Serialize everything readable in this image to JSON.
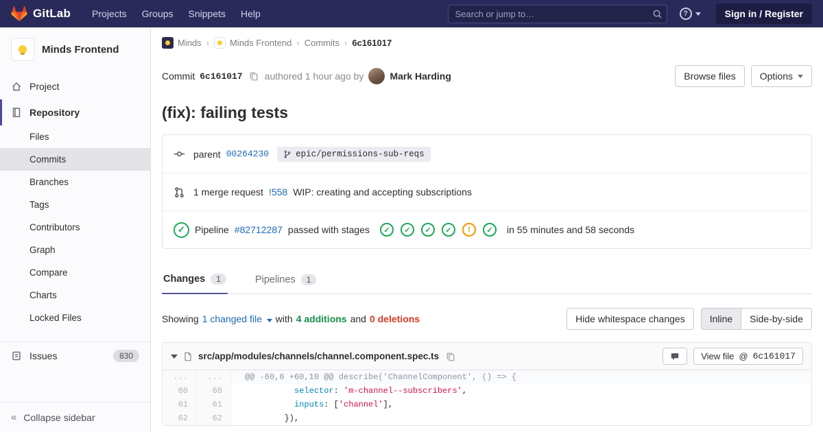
{
  "colors": {
    "navbar_bg": "#2a2a5a",
    "accent_indigo": "#4b4ba3",
    "link_blue": "#1b69b6",
    "success_green": "#1aaa55",
    "warning_orange": "#fc9403",
    "additions_green": "#168f48",
    "deletions_red": "#db3b21"
  },
  "navbar": {
    "brand": "GitLab",
    "menu": [
      "Projects",
      "Groups",
      "Snippets",
      "Help"
    ],
    "search_placeholder": "Search or jump to…",
    "sign_in": "Sign in / Register"
  },
  "sidebar": {
    "project_title": "Minds Frontend",
    "items": {
      "project": "Project",
      "repository": "Repository",
      "issues": "Issues",
      "issues_count": "830",
      "collapse": "Collapse sidebar"
    },
    "repo_sub": [
      "Files",
      "Commits",
      "Branches",
      "Tags",
      "Contributors",
      "Graph",
      "Compare",
      "Charts",
      "Locked Files"
    ]
  },
  "breadcrumb": {
    "separator": "›",
    "items": [
      "Minds",
      "Minds Frontend",
      "Commits",
      "6c161017"
    ]
  },
  "commit": {
    "label": "Commit",
    "sha": "6c161017",
    "authored": "authored 1 hour ago by",
    "author": "Mark Harding",
    "browse_files": "Browse files",
    "options": "Options",
    "title": "(fix): failing tests",
    "parent_label": "parent",
    "parent_sha": "00264230",
    "branch_badge": "epic/permissions-sub-reqs",
    "mr_count_text": "1 merge request",
    "mr_ref": "!558",
    "mr_title": "WIP: creating and accepting subscriptions",
    "pipeline_label": "Pipeline",
    "pipeline_id": "#82712287",
    "pipeline_status": "passed with stages",
    "stages": [
      "success",
      "success",
      "success",
      "success",
      "warning",
      "success"
    ],
    "pipeline_duration": "in 55 minutes and 58 seconds"
  },
  "tabs": {
    "changes": "Changes",
    "changes_count": "1",
    "pipelines": "Pipelines",
    "pipelines_count": "1"
  },
  "changes_bar": {
    "showing": "Showing",
    "changed_file": "1 changed file",
    "with": "with",
    "additions": "4 additions",
    "and": "and",
    "deletions": "0 deletions",
    "hide_whitespace": "Hide whitespace changes",
    "inline": "Inline",
    "side_by_side": "Side-by-side"
  },
  "file": {
    "path": "src/app/modules/channels/channel.component.spec.ts",
    "view_file": "View file",
    "view_at": "@",
    "view_sha": "6c161017"
  },
  "diff": {
    "meta": {
      "old": "...",
      "new": "...",
      "text": "@@ -60,6 +60,10 @@ describe('ChannelComponent', () => {"
    },
    "rows": [
      {
        "old": "60",
        "new": "60",
        "indent": "          ",
        "key": "selector",
        "sep": ": ",
        "pre": "",
        "str": "'m-channel--subscribers'",
        "post": ","
      },
      {
        "old": "61",
        "new": "61",
        "indent": "          ",
        "key": "inputs",
        "sep": ": ",
        "pre": "[",
        "str": "'channel'",
        "post": "],"
      },
      {
        "old": "62",
        "new": "62",
        "indent": "        ",
        "key": "",
        "sep": "",
        "pre": "",
        "str": "",
        "post": "}),"
      }
    ]
  }
}
